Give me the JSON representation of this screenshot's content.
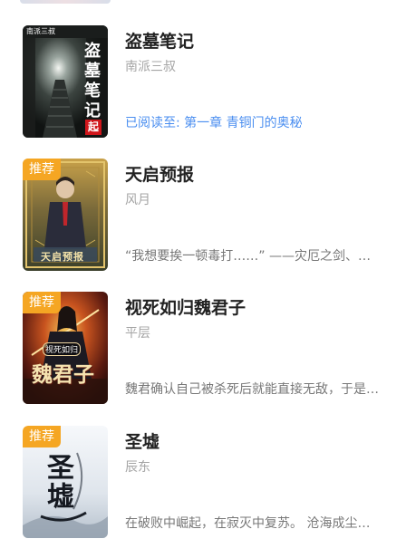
{
  "books": [
    {
      "title": "盗墓笔记",
      "author": "南派三叔",
      "progress": "已阅读至: 第一章 青铜门的奥秘",
      "cover_publisher": "南派三叔",
      "cover_title_chars": [
        "盗",
        "墓",
        "笔",
        "记"
      ],
      "cover_seal": "起",
      "cover_icon": "tomb-stairs-cover"
    },
    {
      "title": "天启预报",
      "author": "风月",
      "badge": "推荐",
      "intro": "“我想要挨一顿毒打……” ——灾厄之剑、旧日之尘、铁骑统领",
      "cover_title": "天启预报",
      "cover_icon": "suited-man-cover"
    },
    {
      "title": "视死如归魏君子",
      "author": "平层",
      "badge": "推荐",
      "intro": "魏君确认自己被杀死后就能直接无敌，于是开始作死",
      "cover_title_top": "视死如归",
      "cover_title_big": "魏君子",
      "cover_icon": "swordsman-cover"
    },
    {
      "title": "圣墟",
      "author": "辰东",
      "badge": "推荐",
      "intro": "在破败中崛起，在寂灭中复苏。 沧海成尘，雷电枯竭",
      "cover_title": "圣墟",
      "cover_icon": "ink-calligraphy-cover"
    }
  ],
  "colors": {
    "badge": "#f5a623",
    "progress_link": "#4a8ef0",
    "title": "#222222",
    "author": "#a5a5a5",
    "intro": "#777777"
  }
}
